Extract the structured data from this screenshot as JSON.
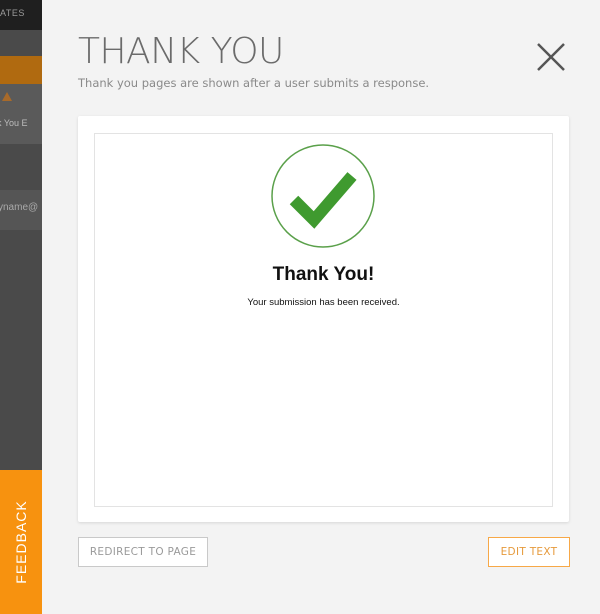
{
  "background": {
    "topbar_text": "ATES",
    "toolbar_label": "k You  E",
    "field_text": "yname@",
    "feedback_label": "FEEDBACK"
  },
  "modal": {
    "title": "THANK YOU",
    "subtitle": "Thank you pages are shown after a user submits a response.",
    "close_icon": "close-icon"
  },
  "preview": {
    "check_icon": "check-circle-icon",
    "heading": "Thank You!",
    "message": "Your submission has been received."
  },
  "actions": {
    "redirect_label": "REDIRECT TO PAGE",
    "edit_text_label": "EDIT TEXT"
  },
  "colors": {
    "accent_orange": "#f7920f",
    "check_green": "#3f9a2f",
    "circle_stroke": "#5aa04a"
  }
}
